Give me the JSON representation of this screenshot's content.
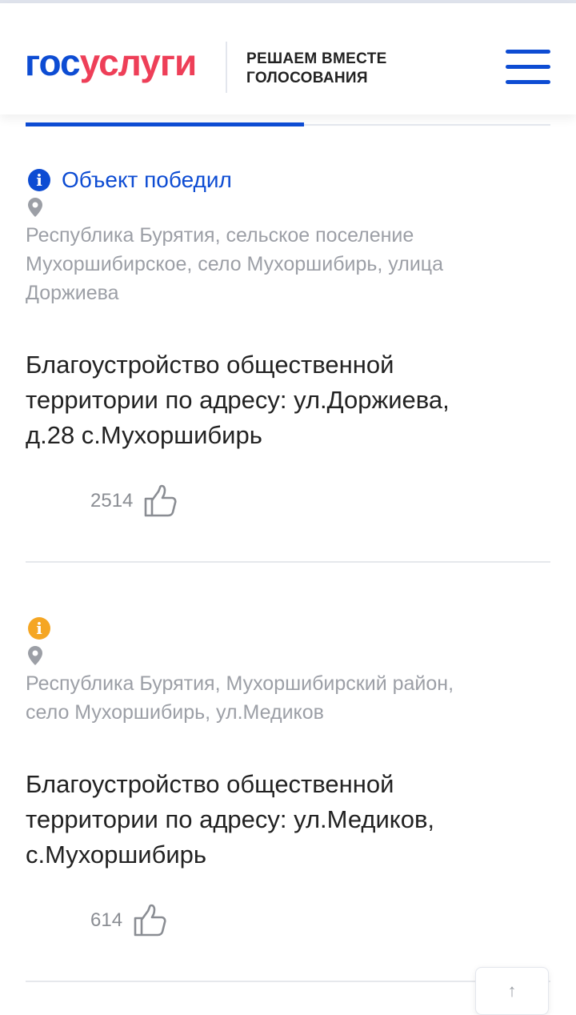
{
  "header": {
    "logo_part1": "гос",
    "logo_part2": "услуги",
    "tagline_line1": "РЕШАЕМ ВМЕСТЕ",
    "tagline_line2": "ГОЛОСОВАНИЯ",
    "brand_blue": "#0d4cd3",
    "brand_red": "#ee3f58"
  },
  "projects": [
    {
      "status_text": "Объект победил",
      "status_color": "#0d4cd3",
      "status_icon": "info-icon",
      "address_line1": "Республика Бурятия, сельское поселение",
      "address_line2": "Мухоршибирское, село Мухоршибирь, улица",
      "address_line3": "Доржиева",
      "title_line1": "Благоустройство общественной",
      "title_line2": "территории по адресу: ул.Доржиева,",
      "title_line3": "д.28 с.Мухоршибирь",
      "likes": "2514"
    },
    {
      "status_text": "",
      "status_color": "#f5a623",
      "status_icon": "info-icon",
      "address_line1": "Республика Бурятия, Мухоршибирский район,",
      "address_line2": "село Мухоршибирь, ул.Медиков",
      "title_line1": "Благоустройство общественной",
      "title_line2": "территории по адресу: ул.Медиков,",
      "title_line3": "с.Мухоршибирь",
      "likes": "614"
    }
  ],
  "scroll_top_icon": "arrow-up-icon"
}
